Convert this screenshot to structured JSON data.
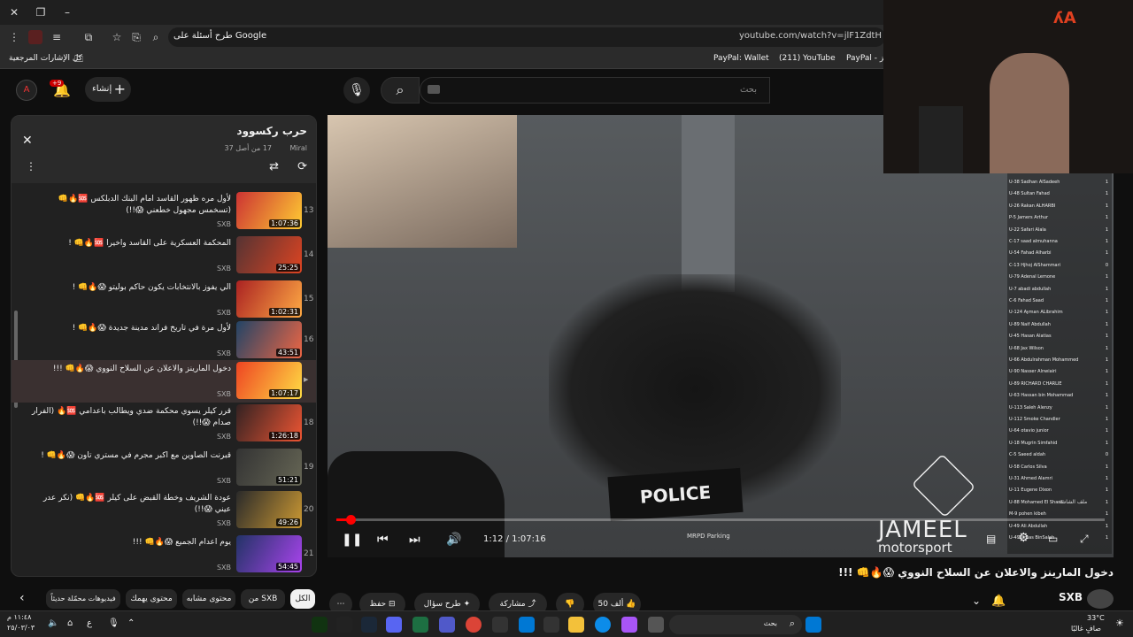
{
  "browser": {
    "url": "youtube.com/watch?v=jlF1ZdtH",
    "omnibox_action": "طرح أسئلة على Google",
    "bookmarks_label": "كل الإشارات المرجعية",
    "bookmarks": [
      "PayPal: Wallet",
      "(211) YouTube",
      "PayPal - وجز"
    ]
  },
  "youtube": {
    "search_placeholder": "بحث",
    "create_label": "إنشاء",
    "notifications_badge": "+9"
  },
  "playlist": {
    "title": "حرب ركسوود",
    "channel": "Miral",
    "position": "17 من أصل 37",
    "items": [
      {
        "index": "13",
        "title": "لأول مره ظهور القاسد امام البنك الدبلكس 🆘🔥👊 (تسخمس مجهول خطعني 😱!!)",
        "channel": "SXB",
        "duration": "1:07:36"
      },
      {
        "index": "14",
        "title": "المحكمة العسكرية على القاسد واخيرا 🆘🔥👊 !",
        "channel": "SXB",
        "duration": "25:25"
      },
      {
        "index": "15",
        "title": "الي يفوز بالانتخابات يكون حاكم بوليتو 😱🔥👊 !",
        "channel": "SXB",
        "duration": "1:02:31"
      },
      {
        "index": "16",
        "title": "لأول مرة في تاريخ فراند مدينة جديدة 😱🔥👊 !",
        "channel": "SXB",
        "duration": "43:51"
      },
      {
        "index": "",
        "title": "دخول المارينز والاعلان عن السلاح النووي 😱🔥👊 !!!",
        "channel": "SXB",
        "duration": "1:07:17"
      },
      {
        "index": "18",
        "title": "قرر كيلر يسوي محكمة ضدي ويطالب باعدامي 🆘🔥 (الفرار صدام 😱!!)",
        "channel": "SXB",
        "duration": "1:26:18"
      },
      {
        "index": "19",
        "title": "قبرنت الصاوين مع اكبر مجرم في مستري تاون 😱🔥👊 !",
        "channel": "SXB",
        "duration": "51:21"
      },
      {
        "index": "20",
        "title": "عودة الشريف وخطة القبض على كيلر 🆘🔥👊 (نكر عدر عيني 😱!!)",
        "channel": "SXB",
        "duration": "49:26"
      },
      {
        "index": "21",
        "title": "يوم اعدام الجميع 😱🔥👊 !!!",
        "channel": "SXB",
        "duration": "54:45"
      }
    ]
  },
  "player": {
    "time": "1:12 / 1:07:16",
    "progress": 0.018,
    "location": "MRPD Parking",
    "police_text": "POLICE",
    "brand_top": "JAMEEL",
    "brand_bottom": "motorsport",
    "scoreboard_side": "ملف الشاشة",
    "scoreboard": [
      [
        "U-38",
        "Sadhan AlSadeeh",
        "1"
      ],
      [
        "U-48",
        "Sultan Fahad",
        "1"
      ],
      [
        "U-26",
        "Rakan ALHARBI",
        "1"
      ],
      [
        "P-5",
        "Jamers Arthur",
        "1"
      ],
      [
        "U-22",
        "Safari Alala",
        "1"
      ],
      [
        "C-17",
        "saad almuhanna",
        "1"
      ],
      [
        "U-54",
        "Fahad Alharbi",
        "1"
      ],
      [
        "C-13",
        "Hjhoj AlShammari",
        "0"
      ],
      [
        "U-79",
        "Adenal Lemone",
        "1"
      ],
      [
        "U-7",
        "abadi abdullah",
        "1"
      ],
      [
        "C-6",
        "Fahad Saad",
        "1"
      ],
      [
        "U-124",
        "Ayman ALibrahim",
        "1"
      ],
      [
        "U-89",
        "Naif Abdullah",
        "1"
      ],
      [
        "U-45",
        "Hasan Alatias",
        "1"
      ],
      [
        "U-68",
        "Jax Wilson",
        "1"
      ],
      [
        "U-66",
        "Abdulrahman Mohammed",
        "1"
      ],
      [
        "U-90",
        "Nasser Alnwiairi",
        "1"
      ],
      [
        "U-89",
        "RICHARD CHARLIE",
        "1"
      ],
      [
        "U-63",
        "Hassan bin Mohammad",
        "1"
      ],
      [
        "U-113",
        "Saleh Alenzy",
        "1"
      ],
      [
        "U-112",
        "Smoke Chandler",
        "1"
      ],
      [
        "U-64",
        "otavio junior",
        "1"
      ],
      [
        "U-18",
        "Mugrin Simfahid",
        "1"
      ],
      [
        "C-5",
        "Saeed aldah",
        "0"
      ],
      [
        "U-58",
        "Carlos Silva",
        "1"
      ],
      [
        "U-31",
        "Ahmed Alamri",
        "1"
      ],
      [
        "U-11",
        "Eugene Dixon",
        "1"
      ],
      [
        "U-88",
        "Mohamed El Sharif",
        "1"
      ],
      [
        "M-9",
        "pohen kibeh",
        "1"
      ],
      [
        "U-49",
        "Ali Abdullah",
        "1"
      ],
      [
        "U-49",
        "Gmas BinSaleh",
        "1"
      ]
    ]
  },
  "video": {
    "title": "دخول المارينز والاعلان عن السلاح النووي 😱🔥👊 !!!",
    "channel": "SXB",
    "likes": "50 ألف",
    "share_label": "مشاركة",
    "ask_label": "طرح سؤال",
    "save_label": "حفظ"
  },
  "chips": [
    "الكل",
    "من SXB",
    "محتوى مشابه",
    "محتوى يهمك",
    "فيديوهات محمّلة حديثاً"
  ],
  "taskbar": {
    "search_placeholder": "بحث",
    "temperature": "33°C",
    "weather": "صافٍ غالبًا",
    "time": "١١:٤٨ م",
    "date": "٢٥/٠٣/٠٣",
    "lang": "ع"
  },
  "colors": {
    "accent_red": "#ff0000",
    "panel": "#212121",
    "bg": "#0f0f0f"
  }
}
